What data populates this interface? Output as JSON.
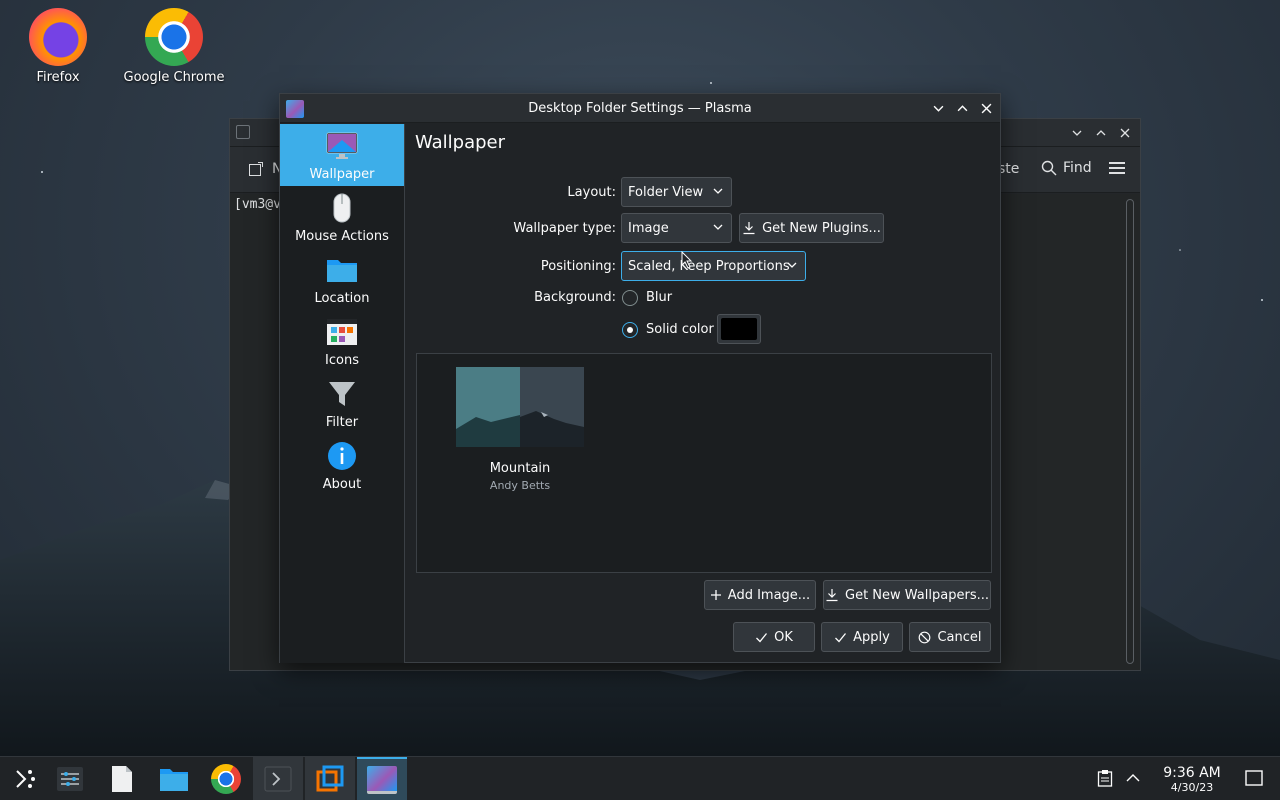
{
  "desktop": {
    "icons": [
      {
        "label": "Firefox",
        "icon": "firefox-icon"
      },
      {
        "label": "Google Chrome",
        "icon": "chrome-icon"
      }
    ]
  },
  "konsole": {
    "toolbar_new_fragment": "N",
    "toolbar_paste_fragment": "ste",
    "find_label": "Find",
    "prompt_fragment": "[vm3@v"
  },
  "dialog": {
    "title": "Desktop Folder Settings — Plasma",
    "sidebar": [
      {
        "label": "Wallpaper",
        "icon": "monitor-icon",
        "active": true
      },
      {
        "label": "Mouse Actions",
        "icon": "mouse-icon"
      },
      {
        "label": "Location",
        "icon": "folder-icon"
      },
      {
        "label": "Icons",
        "icon": "icons-grid-icon"
      },
      {
        "label": "Filter",
        "icon": "funnel-icon"
      },
      {
        "label": "About",
        "icon": "info-icon"
      }
    ],
    "heading": "Wallpaper",
    "form": {
      "layout_label": "Layout:",
      "layout_value": "Folder View",
      "wallpaper_type_label": "Wallpaper type:",
      "wallpaper_type_value": "Image",
      "get_new_plugins": "Get New Plugins...",
      "positioning_label": "Positioning:",
      "positioning_value": "Scaled, Keep Proportions",
      "background_label": "Background:",
      "blur_label": "Blur",
      "solid_color_label": "Solid color",
      "solid_color": "#000000",
      "selected_background": "Solid color"
    },
    "wallpapers": [
      {
        "name": "Mountain",
        "author": "Andy Betts"
      }
    ],
    "add_image": "Add Image...",
    "get_new_wallpapers": "Get New Wallpapers...",
    "ok": "OK",
    "apply": "Apply",
    "cancel": "Cancel"
  },
  "taskbar": {
    "items": [
      {
        "icon": "app-launcher-icon"
      },
      {
        "icon": "system-settings-icon"
      },
      {
        "icon": "text-file-icon"
      },
      {
        "icon": "file-manager-icon"
      },
      {
        "icon": "chrome-icon"
      },
      {
        "icon": "konsole-icon",
        "state": "open"
      },
      {
        "icon": "virtualbox-icon"
      },
      {
        "icon": "plasma-settings-icon",
        "state": "active"
      }
    ],
    "time": "9:36 AM",
    "date": "4/30/23"
  },
  "colors": {
    "accent": "#3daee9",
    "window_bg": "#202326",
    "sidebar_bg": "#1b1e20"
  }
}
